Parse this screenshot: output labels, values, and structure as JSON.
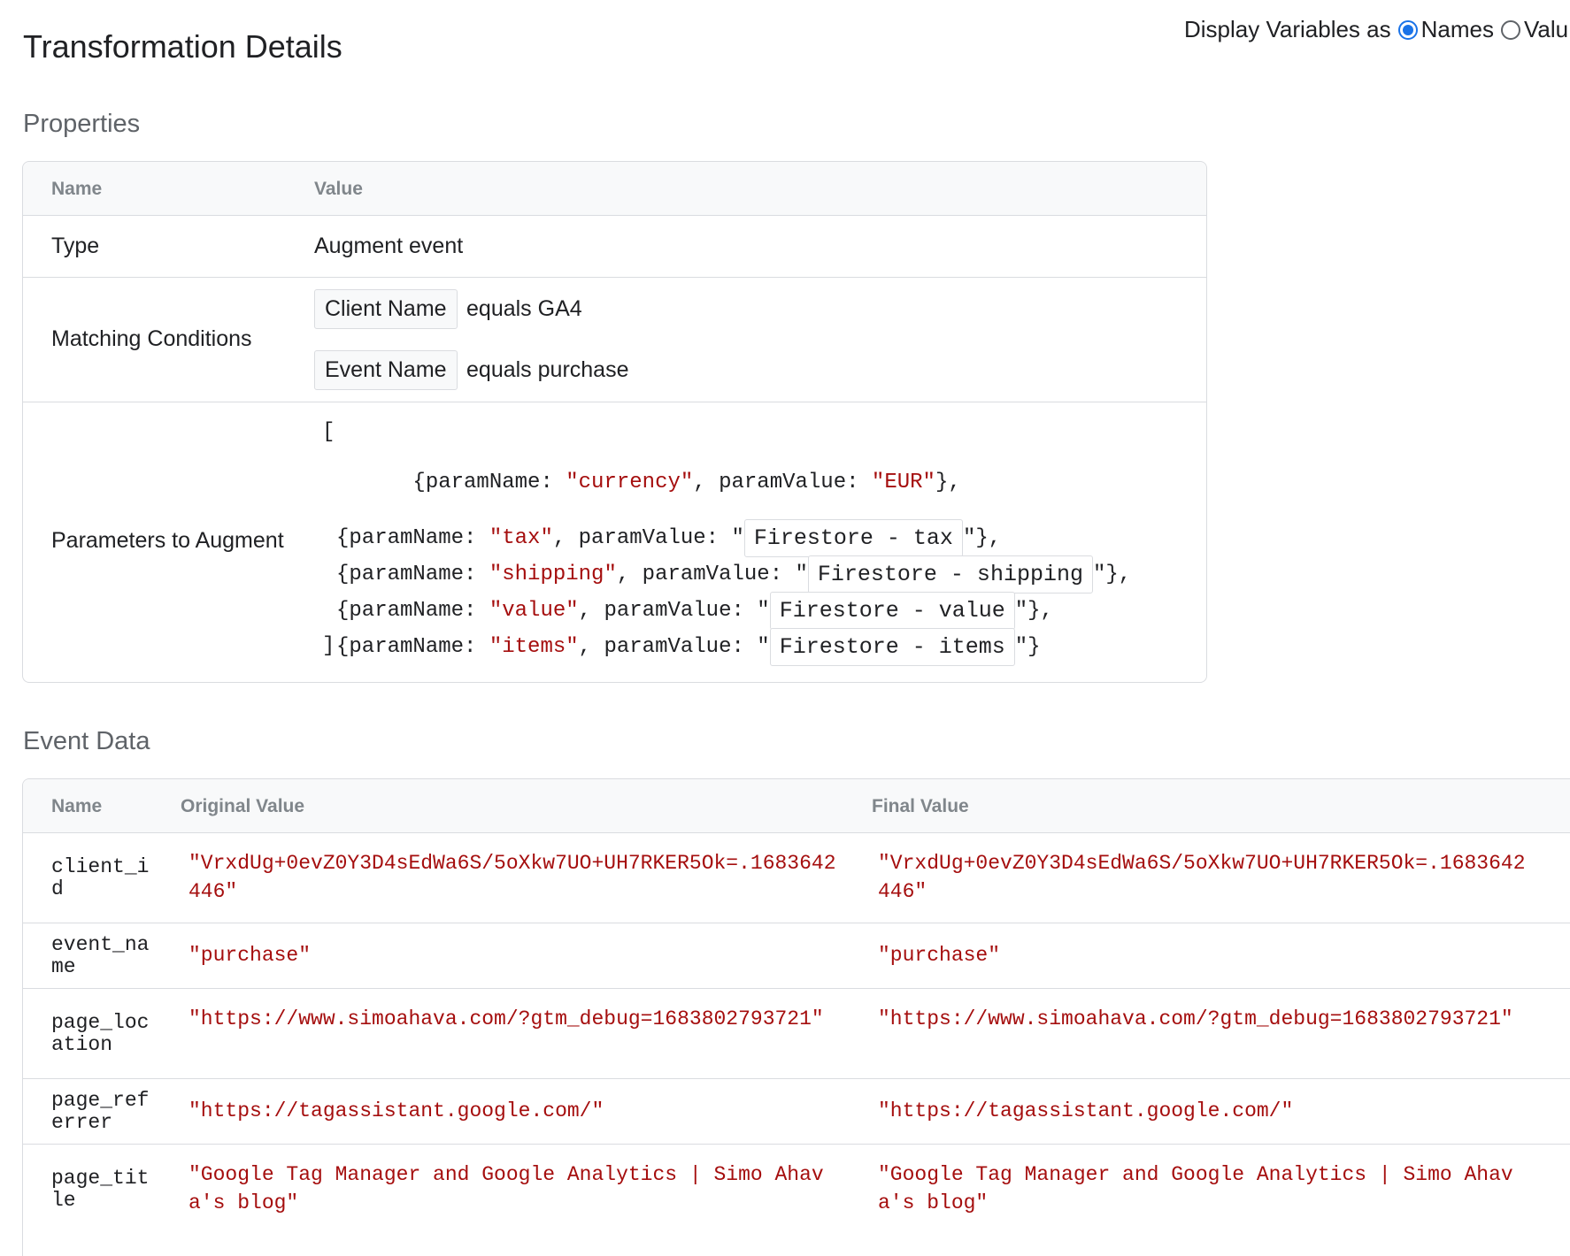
{
  "page": {
    "title": "Transformation Details"
  },
  "display_variables": {
    "label": "Display Variables as",
    "options": [
      {
        "label": "Names",
        "selected": true
      },
      {
        "label": "Valu",
        "selected": false
      }
    ]
  },
  "properties": {
    "section_title": "Properties",
    "headers": {
      "name": "Name",
      "value": "Value"
    },
    "type": {
      "name": "Type",
      "value": "Augment event"
    },
    "matching_conditions": {
      "name": "Matching Conditions",
      "conditions": [
        {
          "variable": "Client Name",
          "rest": "equals GA4"
        },
        {
          "variable": "Event Name",
          "rest": "equals purchase"
        }
      ]
    },
    "parameters": {
      "name": "Parameters to Augment",
      "open_bracket": "[",
      "close_bracket": "]",
      "lines": [
        {
          "prefix": "{paramName: ",
          "param": "\"currency\"",
          "mid": ", paramValue: ",
          "literal": "\"EUR\"",
          "suffix": "},"
        },
        {
          "prefix": "{paramName: ",
          "param": "\"tax\"",
          "mid": ", paramValue: \"",
          "variable": "Firestore - tax",
          "suffix": "\"},"
        },
        {
          "prefix": "{paramName: ",
          "param": "\"shipping\"",
          "mid": ", paramValue: \"",
          "variable": "Firestore - shipping",
          "suffix": "\"},"
        },
        {
          "prefix": "{paramName: ",
          "param": "\"value\"",
          "mid": ", paramValue: \"",
          "variable": "Firestore - value",
          "suffix": "\"},"
        },
        {
          "prefix": "{paramName: ",
          "param": "\"items\"",
          "mid": ", paramValue: \"",
          "variable": "Firestore - items",
          "suffix": "\"}"
        }
      ]
    }
  },
  "event_data": {
    "section_title": "Event Data",
    "headers": {
      "name": "Name",
      "original": "Original Value",
      "final": "Final Value"
    },
    "rows": [
      {
        "name": "client_id",
        "original": "\"VrxdUg+0evZ0Y3D4sEdWa6S/5oXkw7UO+UH7RKER5Ok=.1683642446\"",
        "final": "\"VrxdUg+0evZ0Y3D4sEdWa6S/5oXkw7UO+UH7RKER5Ok=.1683642446\""
      },
      {
        "name": "event_name",
        "original": "\"purchase\"",
        "final": "\"purchase\""
      },
      {
        "name": "page_location",
        "original": "\"https://www.simoahava.com/?gtm_debug=1683802793721\"",
        "final": "\"https://www.simoahava.com/?gtm_debug=1683802793721\""
      },
      {
        "name": "page_referrer",
        "original": "\"https://tagassistant.google.com/\"",
        "final": "\"https://tagassistant.google.com/\""
      },
      {
        "name": "page_title",
        "original": "\"Google Tag Manager and Google Analytics | Simo Ahava's blog\"",
        "final": "\"Google Tag Manager and Google Analytics | Simo Ahava's blog\""
      }
    ]
  }
}
